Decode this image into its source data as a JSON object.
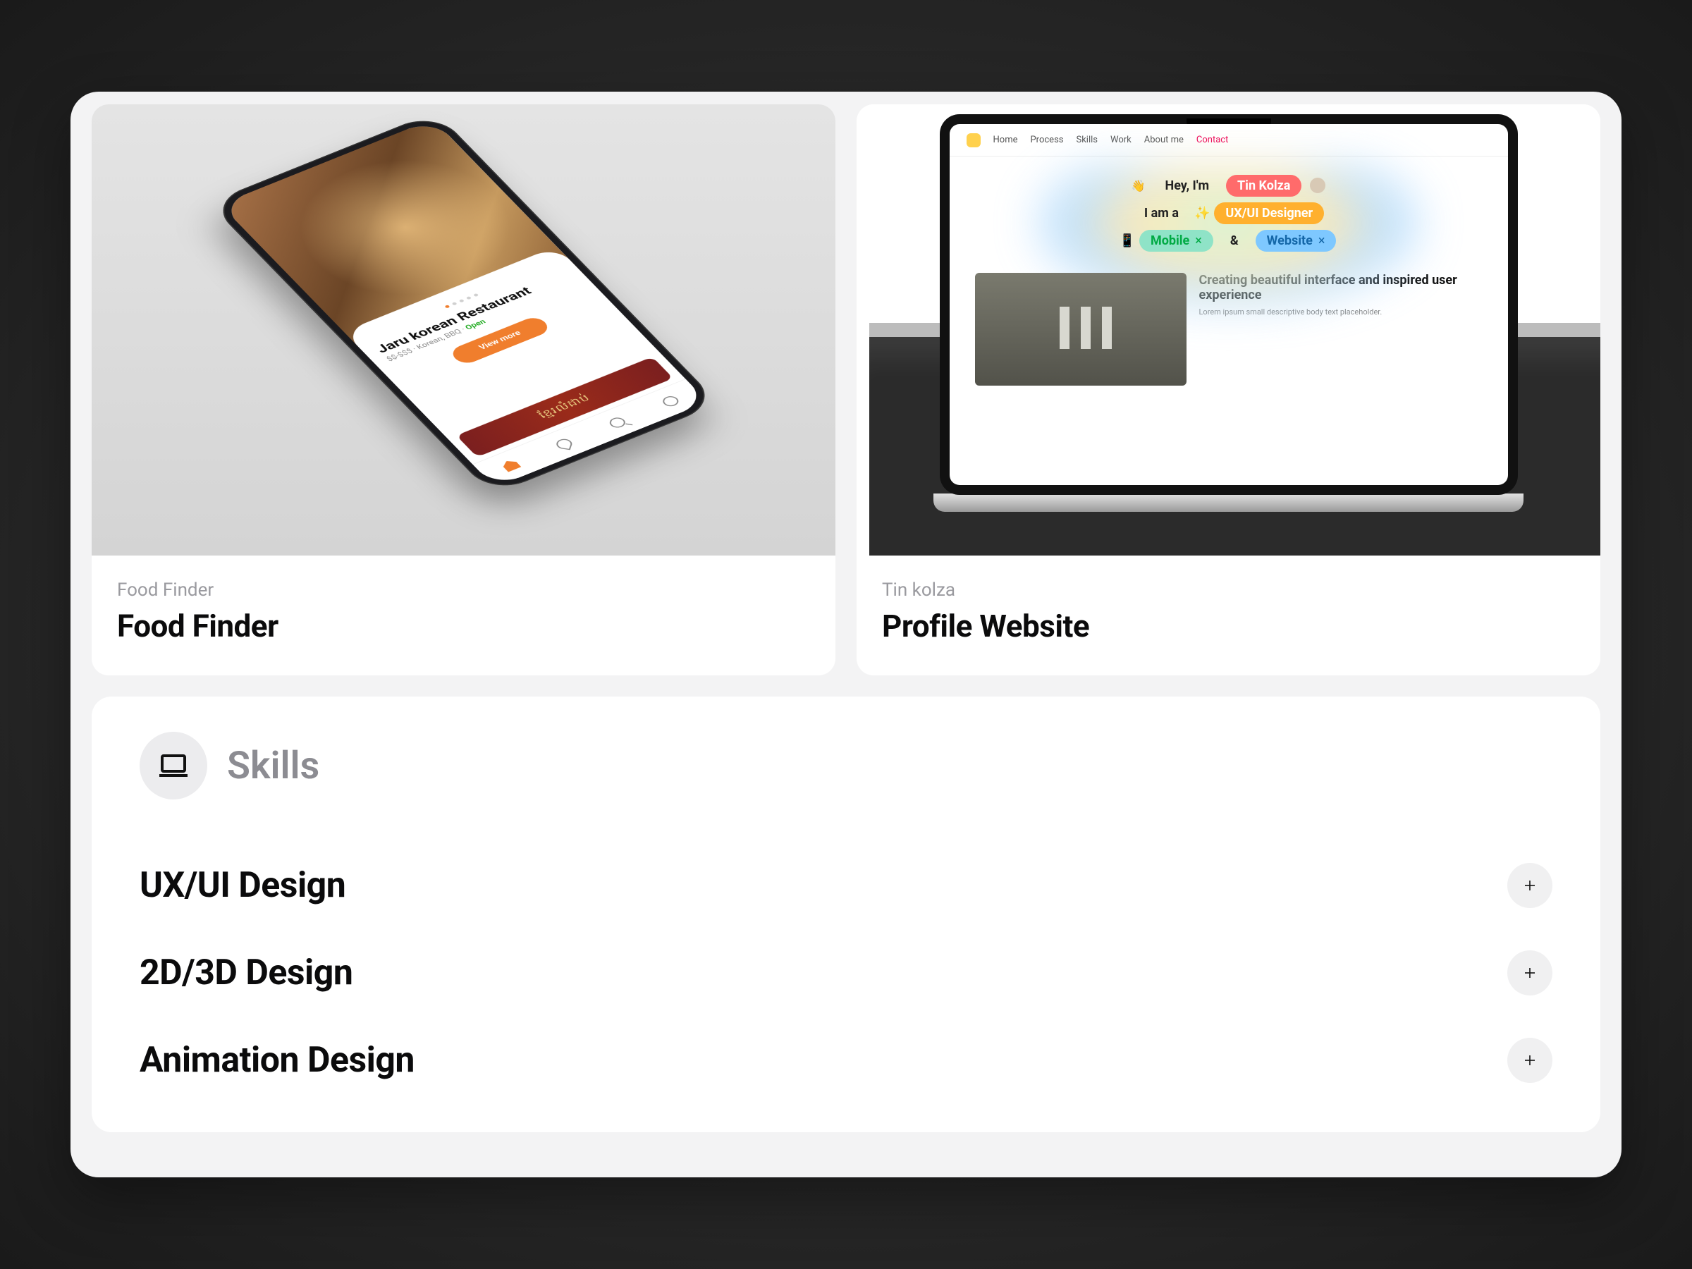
{
  "projects": [
    {
      "client": "Food Finder",
      "title": "Food Finder",
      "mock": {
        "restaurant_name": "Jaru korean Restaurant",
        "meta_line": "$$-$$$ · Korean, BBQ · ",
        "status": "Open",
        "cta": "View more",
        "banner_text": "ខ្មែរលំដាប់"
      }
    },
    {
      "client": "Tin kolza",
      "title": "Profile Website",
      "mock": {
        "nav_items": [
          "Home",
          "Process",
          "Skills",
          "Work",
          "About me",
          "Contact"
        ],
        "hero_line1_prefix": "Hey, I'm",
        "hero_line1_chip": "Tin Kolza",
        "hero_line2_prefix": "I am a",
        "hero_line2_chip": "UX/UI Designer",
        "hero_line3_chip1": "Mobile",
        "hero_line3_amp": "&",
        "hero_line3_chip2": "Website",
        "section_title": "Creating beautiful interface and inspired user experience",
        "section_body": "Lorem ipsum small descriptive body text placeholder."
      }
    }
  ],
  "skills": {
    "heading": "Skills",
    "items": [
      {
        "name": "UX/UI Design"
      },
      {
        "name": "2D/3D Design"
      },
      {
        "name": "Animation Design"
      }
    ]
  }
}
